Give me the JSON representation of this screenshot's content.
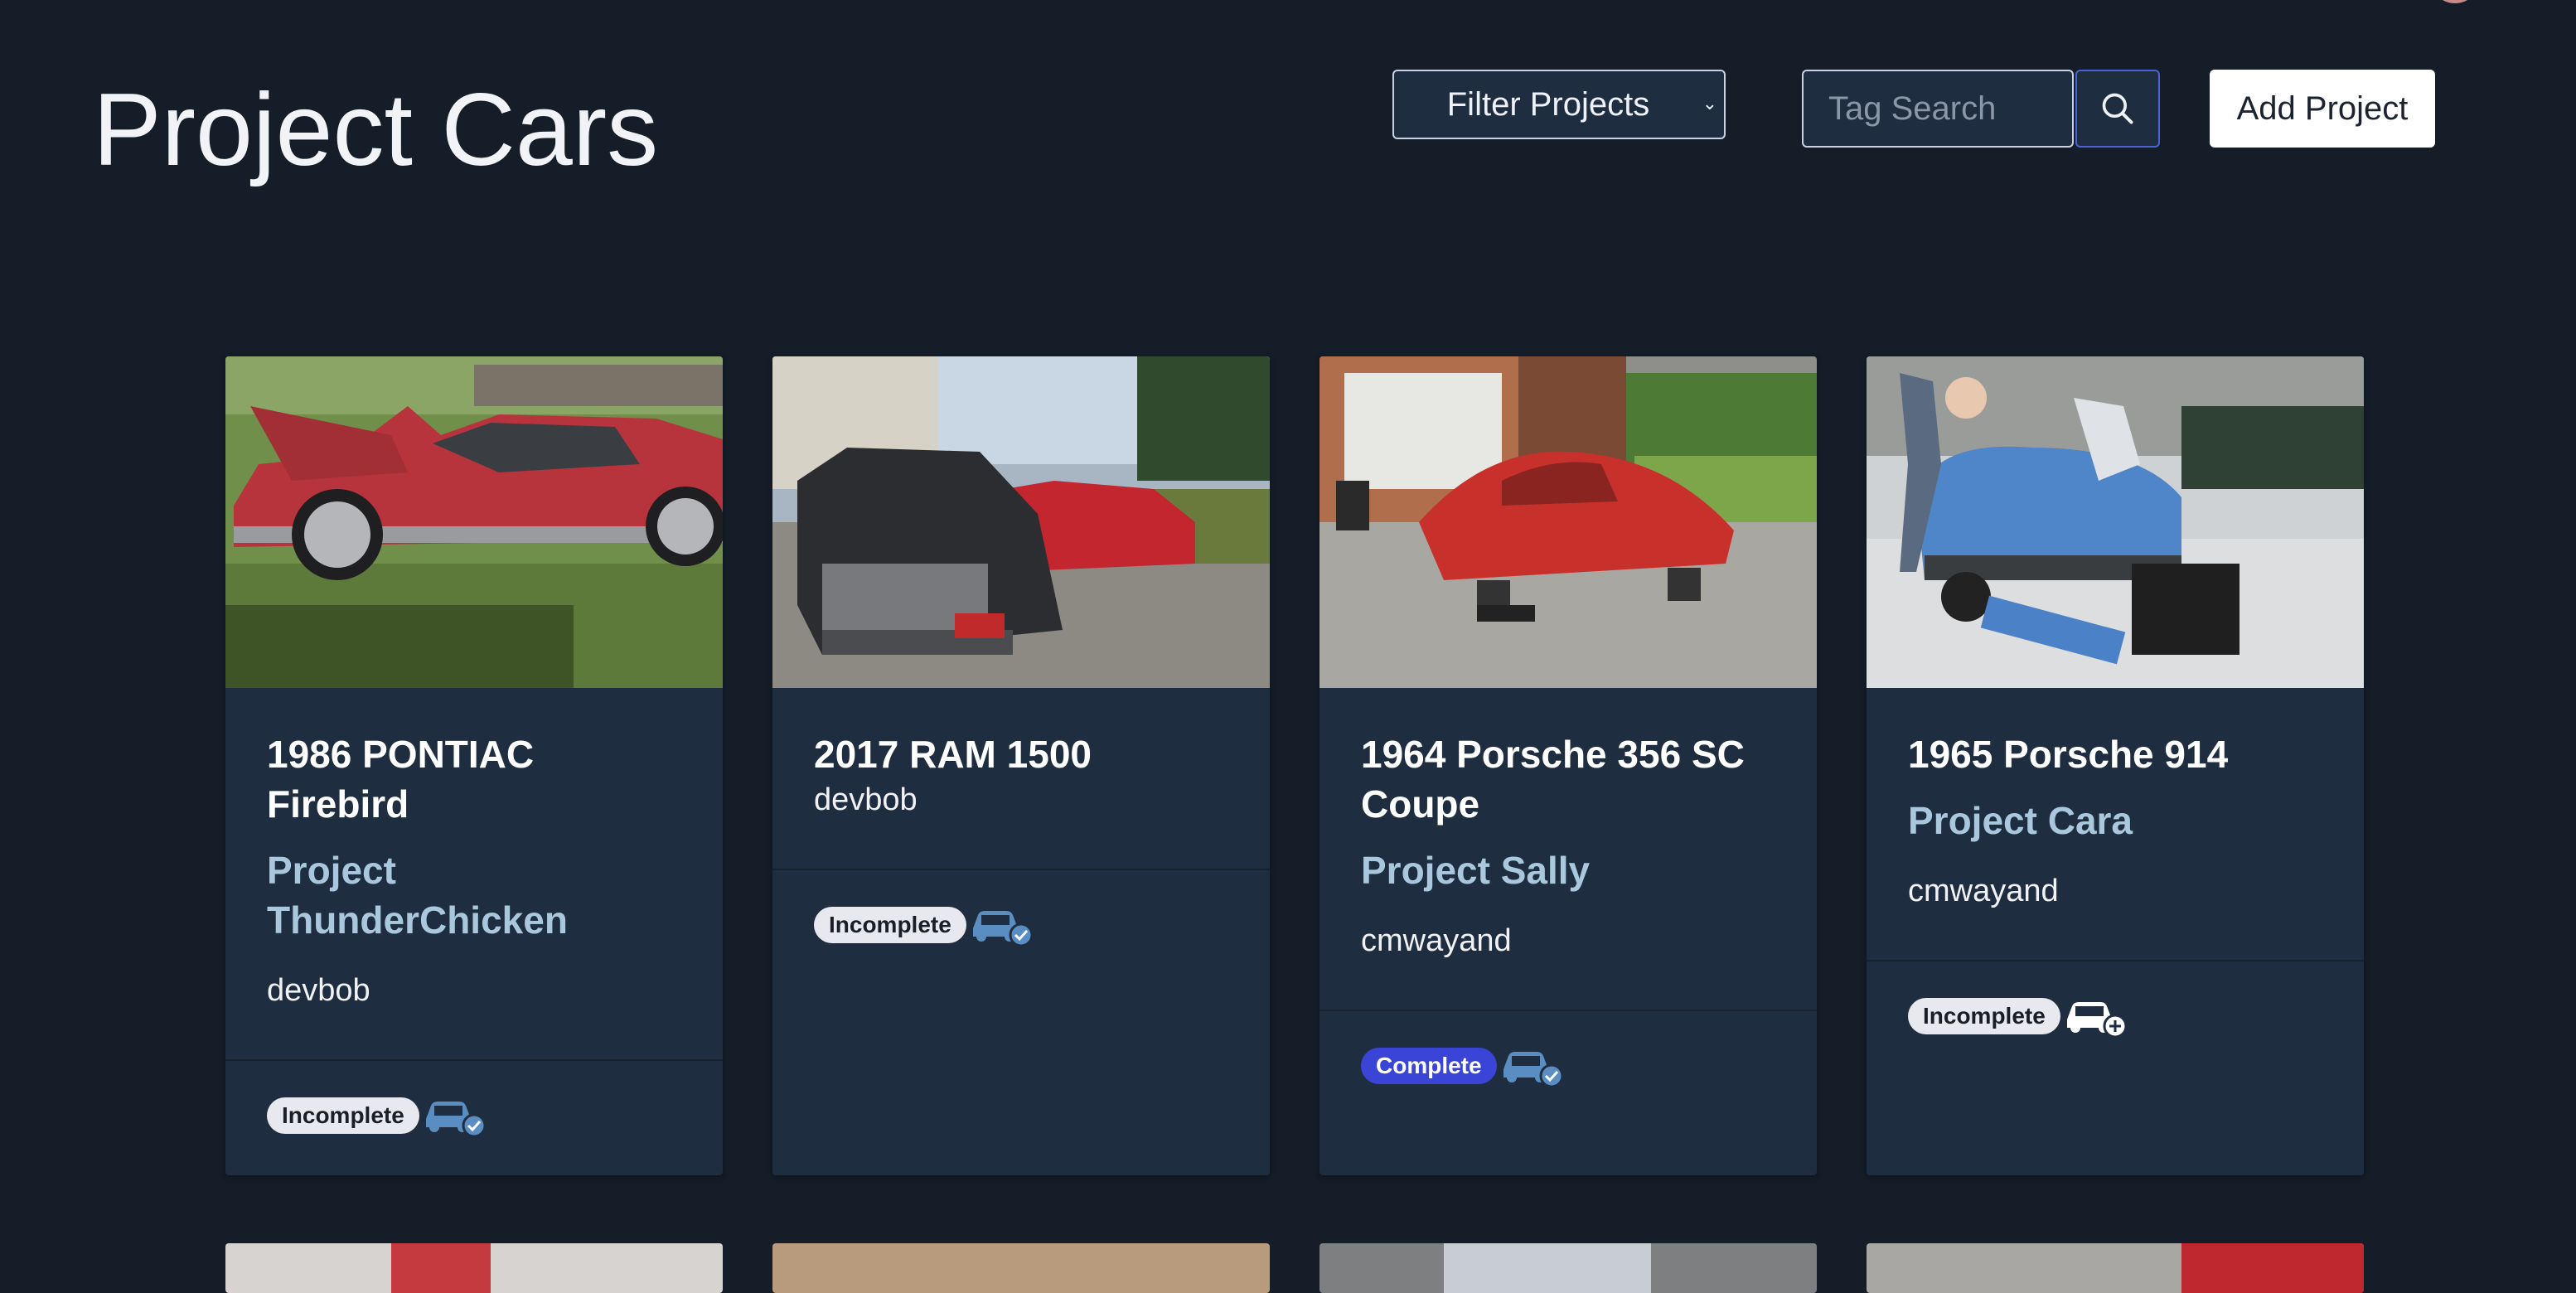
{
  "header": {
    "title": "Project Cars",
    "filter_label": "Filter Projects",
    "tag_search_placeholder": "Tag Search",
    "add_project_label": "Add Project"
  },
  "colors": {
    "background": "#141d28",
    "card": "#1f2d40",
    "project_name": "#a9c8dd",
    "complete_badge": "#3a45d8",
    "incomplete_badge": "#e7e9ee",
    "icon_blue": "#5a8ec2"
  },
  "projects": [
    {
      "title": "1986 PONTIAC Firebird",
      "project_name": "Project ThunderChicken",
      "owner": "devbob",
      "status": "Incomplete",
      "icon": "car-check-icon"
    },
    {
      "title": "2017 RAM 1500",
      "project_name": "",
      "owner": "devbob",
      "status": "Incomplete",
      "icon": "car-check-icon"
    },
    {
      "title": "1964 Porsche 356 SC Coupe",
      "project_name": "Project Sally",
      "owner": "cmwayand",
      "status": "Complete",
      "icon": "car-check-icon"
    },
    {
      "title": "1965 Porsche 914",
      "project_name": "Project Cara",
      "owner": "cmwayand",
      "status": "Incomplete",
      "icon": "car-plus-icon"
    }
  ]
}
